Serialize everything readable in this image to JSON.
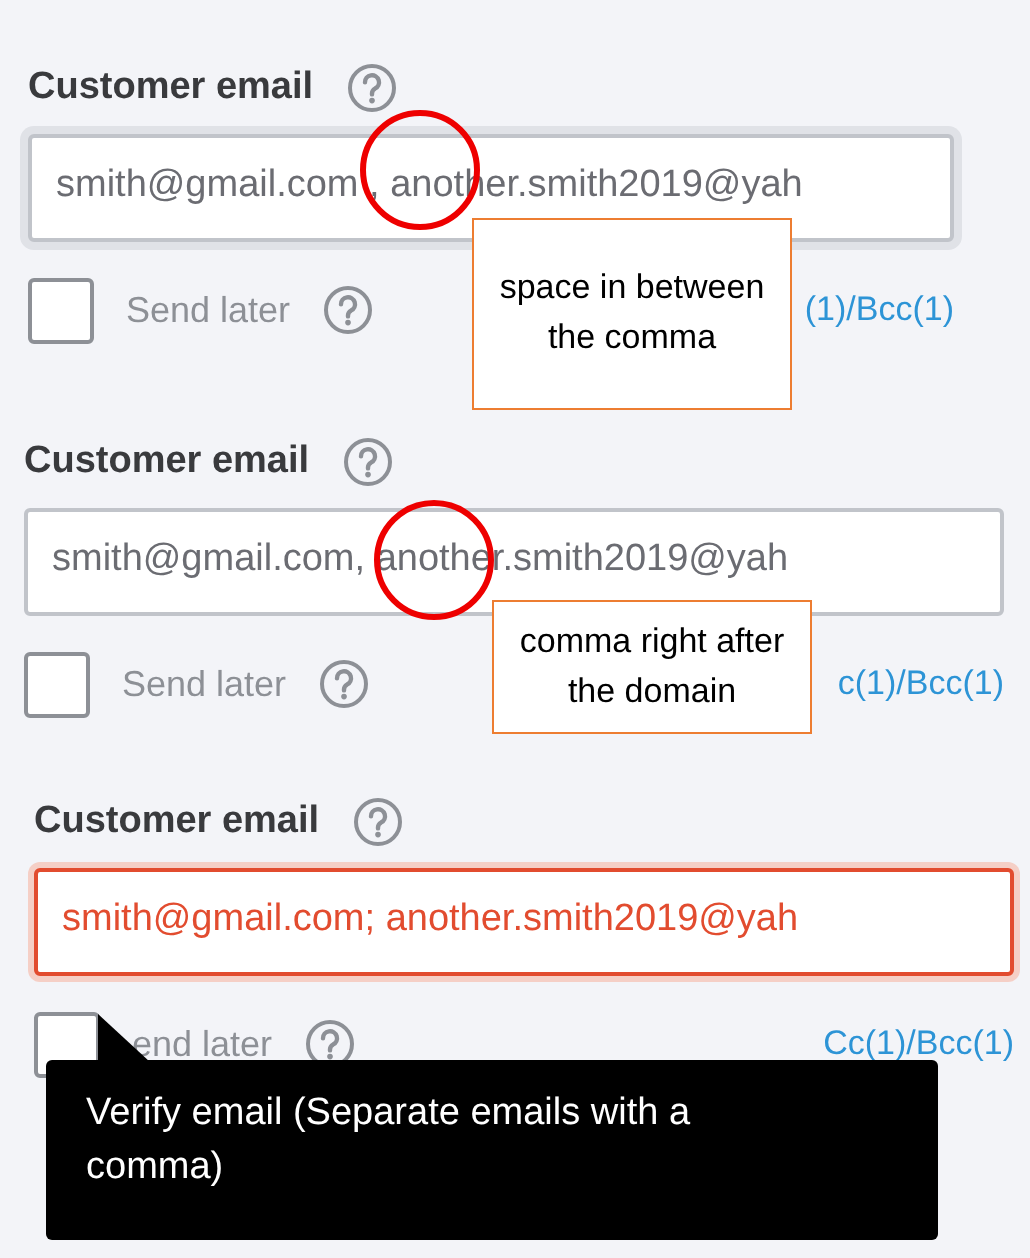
{
  "panels": [
    {
      "label": "Customer email",
      "field": {
        "value": "smith@gmail.com , another.smith2019@yah",
        "focused": true,
        "error": false
      },
      "send_later": {
        "label": "Send later",
        "checked": false
      },
      "cc_link": "(1)/Bcc(1)",
      "annotation": {
        "kind": "callout",
        "text": "space in between the comma"
      }
    },
    {
      "label": "Customer email",
      "field": {
        "value": "smith@gmail.com, another.smith2019@yah",
        "focused": false,
        "error": false
      },
      "send_later": {
        "label": "Send later",
        "checked": false
      },
      "cc_link": "c(1)/Bcc(1)",
      "annotation": {
        "kind": "callout",
        "text": "comma right after the domain"
      }
    },
    {
      "label": "Customer email",
      "field": {
        "value": "smith@gmail.com; another.smith2019@yah",
        "focused": false,
        "error": true
      },
      "send_later": {
        "label": "end later",
        "checked": false
      },
      "cc_link": "Cc(1)/Bcc(1)",
      "annotation": {
        "kind": "tooltip",
        "text": "Verify email (Separate emails with a comma)"
      }
    }
  ]
}
